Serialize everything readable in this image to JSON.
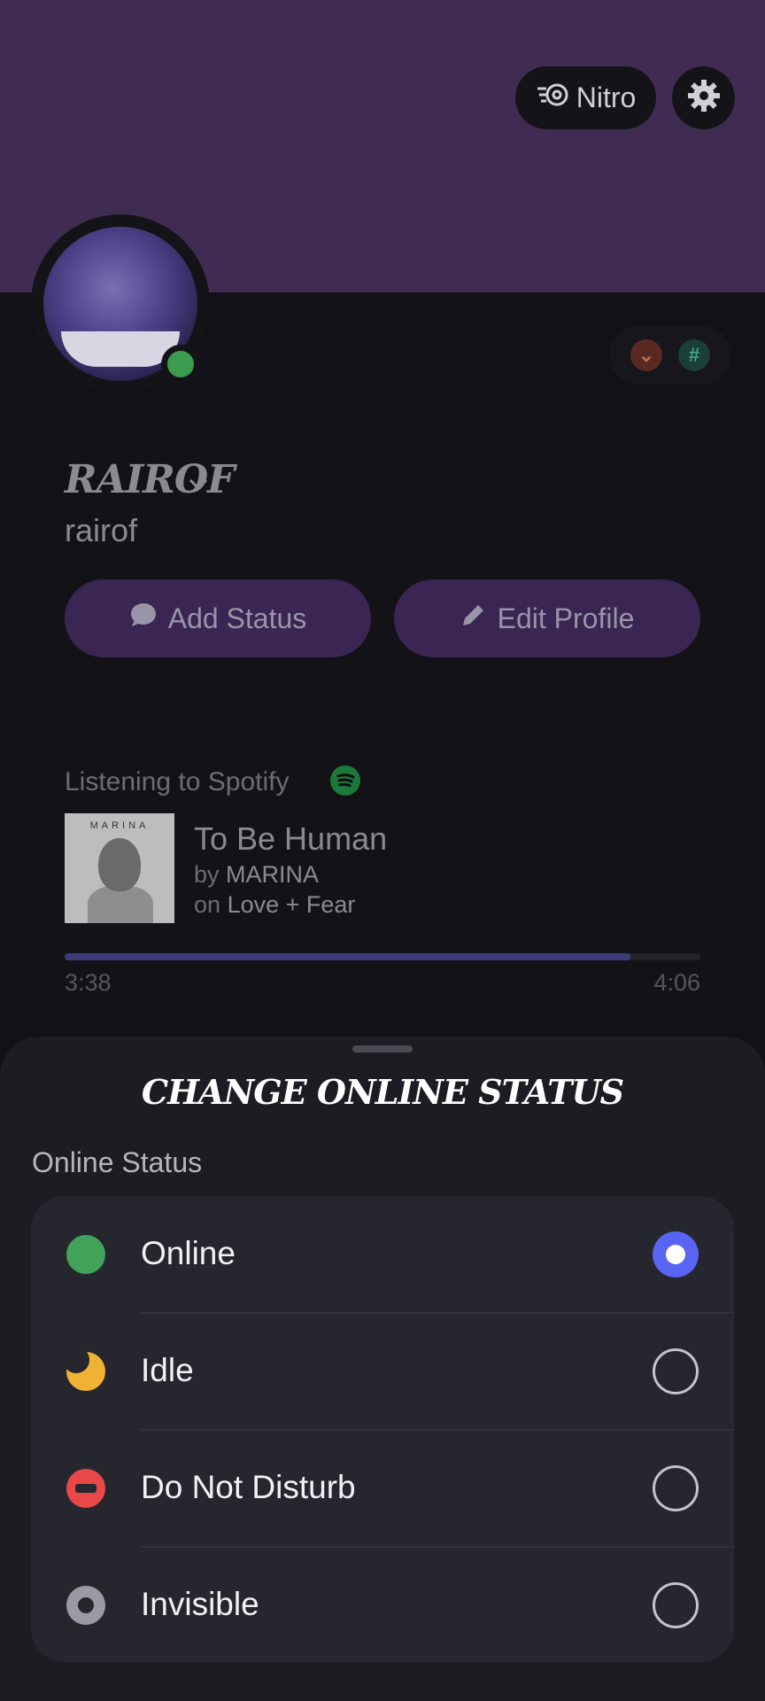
{
  "header": {
    "nitro_label": "Nitro",
    "nitro_icon": "nitro-icon",
    "settings_icon": "gear-icon"
  },
  "profile": {
    "display_name": "RAIROF",
    "username": "rairof",
    "status_color": "#3d9b4f",
    "badges": [
      {
        "icon": "chevron-badge-icon",
        "color": "#a0402a"
      },
      {
        "icon": "hashtag-badge-icon",
        "color": "#1f6f5a"
      }
    ],
    "add_status_label": "Add Status",
    "edit_profile_label": "Edit Profile"
  },
  "spotify": {
    "label": "Listening to Spotify",
    "album_art_text": "MARINA",
    "track_title": "To Be Human",
    "by_prefix": "by",
    "artist": "MARINA",
    "on_prefix": "on",
    "album": "Love + Fear",
    "elapsed": "3:38",
    "duration": "4:06",
    "progress": 0.89
  },
  "sheet": {
    "title": "CHANGE ONLINE STATUS",
    "section_label": "Online Status",
    "options": [
      {
        "label": "Online",
        "icon": "online-status-icon",
        "color": "#43a25a",
        "selected": true
      },
      {
        "label": "Idle",
        "icon": "idle-moon-icon",
        "color": "#f0b232",
        "selected": false
      },
      {
        "label": "Do Not Disturb",
        "icon": "dnd-icon",
        "color": "#e84848",
        "selected": false
      },
      {
        "label": "Invisible",
        "icon": "invisible-icon",
        "color": "#9a9aa6",
        "selected": false
      }
    ]
  }
}
